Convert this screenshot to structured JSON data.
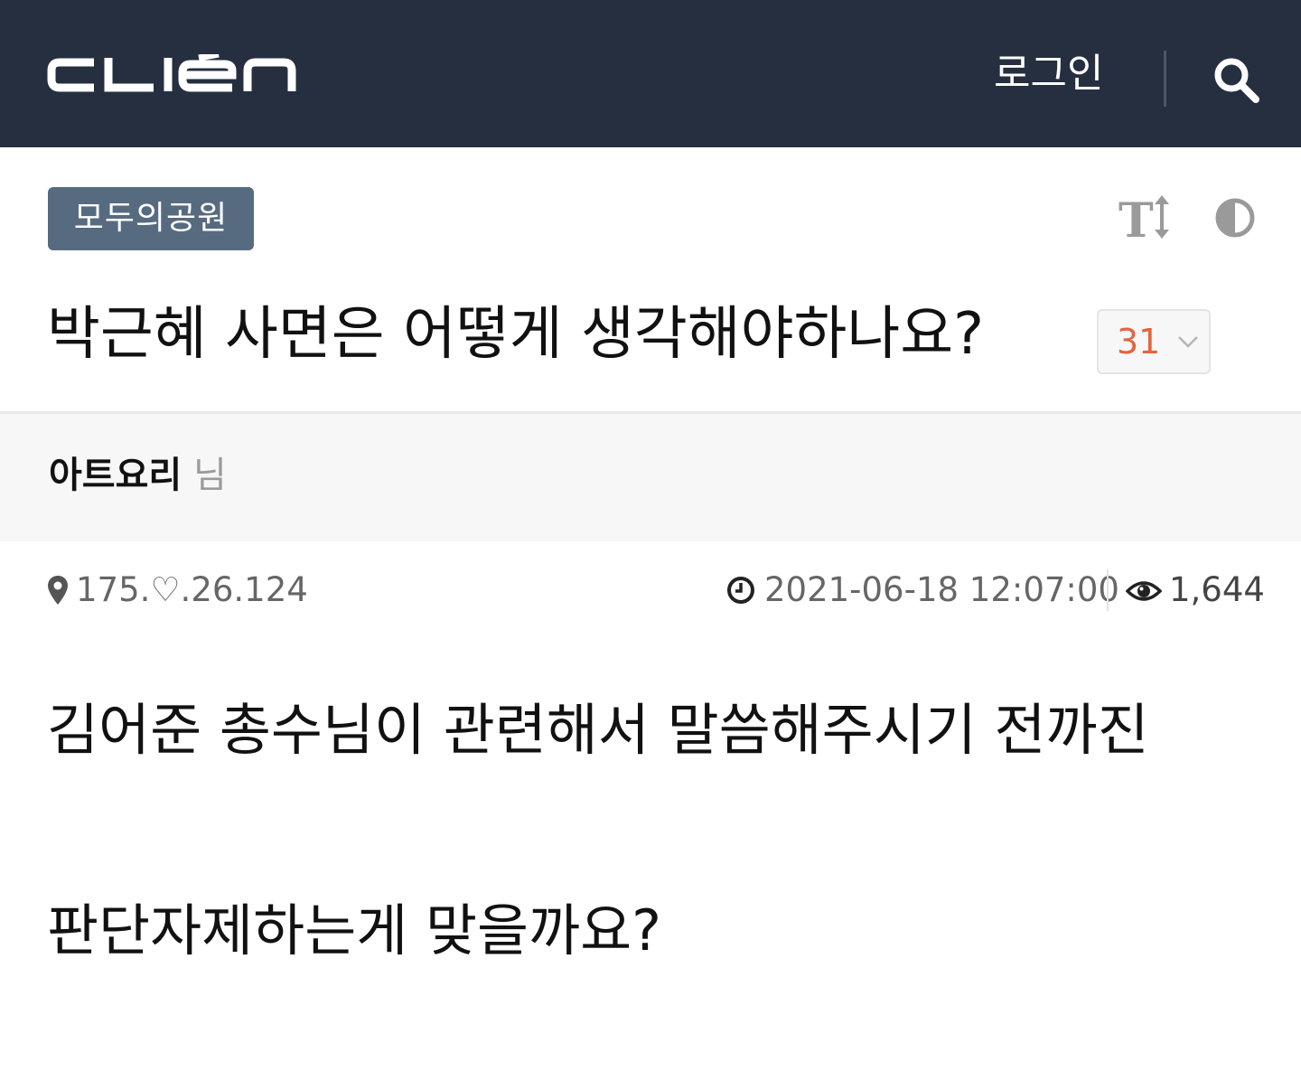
{
  "header": {
    "logo_text": "CLIEN",
    "login_label": "로그인",
    "search_icon": "search-icon",
    "background": "#262f40"
  },
  "board": {
    "name": "모두의공원",
    "badge_color": "#576b80",
    "font_size_icon": "text-size-icon",
    "theme_icon": "contrast-icon"
  },
  "post": {
    "title": "박근혜 사면은 어떻게 생각해야하나요?",
    "comment_count": "31",
    "comment_count_color": "#e6633e",
    "author": {
      "name": "아트요리",
      "suffix": "님"
    },
    "meta": {
      "ip": "175.♡.26.124",
      "datetime": "2021-06-18 12:07:00",
      "views": "1,644"
    },
    "body": [
      "김어준 총수님이 관련해서 말씀해주시기 전까진",
      "판단자제하는게 맞을까요?"
    ]
  }
}
